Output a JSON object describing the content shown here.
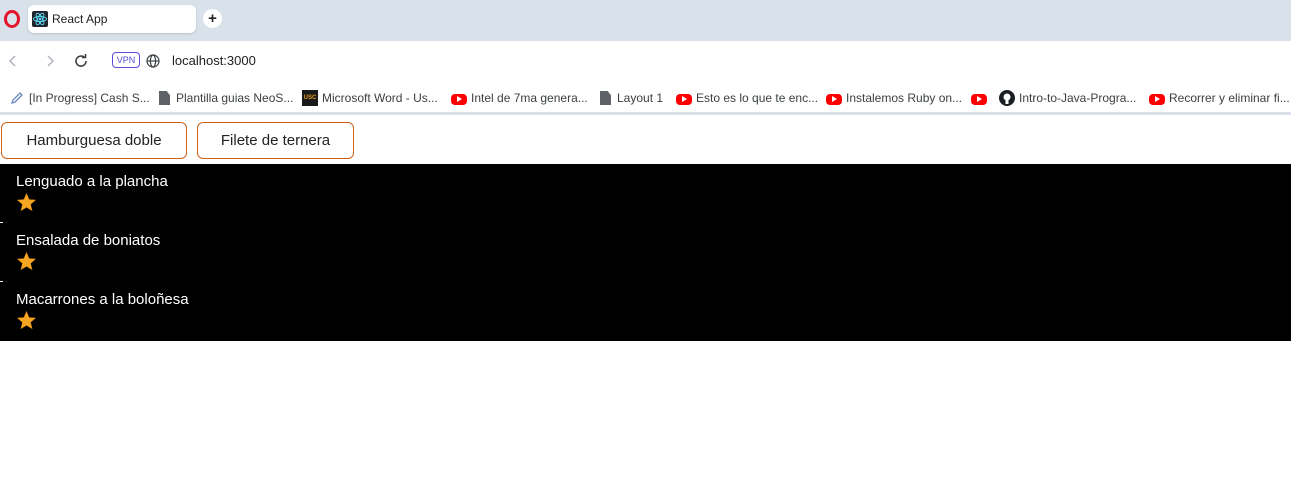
{
  "browser": {
    "tab": {
      "title": "React App",
      "favicon": "react-icon"
    },
    "new_tab_label": "+",
    "address": {
      "vpn_label": "VPN",
      "url": "localhost:3000"
    },
    "bookmarks": [
      {
        "label": "[In Progress] Cash S...",
        "icon": "pen-icon"
      },
      {
        "label": "Plantilla guias NeoS...",
        "icon": "document-icon"
      },
      {
        "label": "Microsoft Word - Us...",
        "icon": "usc-icon"
      },
      {
        "label": "Intel de 7ma genera...",
        "icon": "youtube-icon"
      },
      {
        "label": "Layout 1",
        "icon": "document-icon"
      },
      {
        "label": "Esto es lo que te enc...",
        "icon": "youtube-icon"
      },
      {
        "label": "Instalemos Ruby on...",
        "icon": "youtube-icon"
      },
      {
        "label": "",
        "icon": "youtube-icon"
      },
      {
        "label": "Intro-to-Java-Progra...",
        "icon": "github-icon"
      },
      {
        "label": "Recorrer y eliminar fi...",
        "icon": "youtube-icon"
      }
    ]
  },
  "page": {
    "buttons": [
      {
        "label": "Hamburguesa doble"
      },
      {
        "label": "Filete de ternera"
      }
    ],
    "items": [
      {
        "name": "Lenguado a la plancha",
        "rating": 1
      },
      {
        "name": "Ensalada de boniatos",
        "rating": 1
      },
      {
        "name": "Macarrones a la boloñesa",
        "rating": 1
      }
    ]
  },
  "colors": {
    "tabstrip": "#d9e1ea",
    "button_border": "#d2601a",
    "list_background": "#000000",
    "star": "#f5a623"
  }
}
